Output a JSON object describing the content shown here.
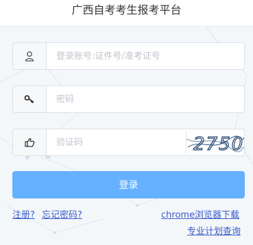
{
  "header": {
    "title": "广西自考考生报考平台"
  },
  "form": {
    "username": {
      "placeholder": "登录账号:证件号/准考证号",
      "value": "",
      "icon": "user-icon"
    },
    "password": {
      "placeholder": "密码",
      "value": "",
      "icon": "key-icon"
    },
    "captcha": {
      "placeholder": "验证码",
      "value": "",
      "icon": "thumb-pointer-icon",
      "image_text": "2750"
    },
    "submit_label": "登录"
  },
  "links": {
    "register": "注册?",
    "forgot_password": "忘记密码?",
    "chrome_download": "chrome浏览器下载",
    "plan_query": "专业计划查询"
  },
  "colors": {
    "primary_button": "#66b1ff",
    "link": "#3b5bc6",
    "border": "#dcdfe6"
  }
}
